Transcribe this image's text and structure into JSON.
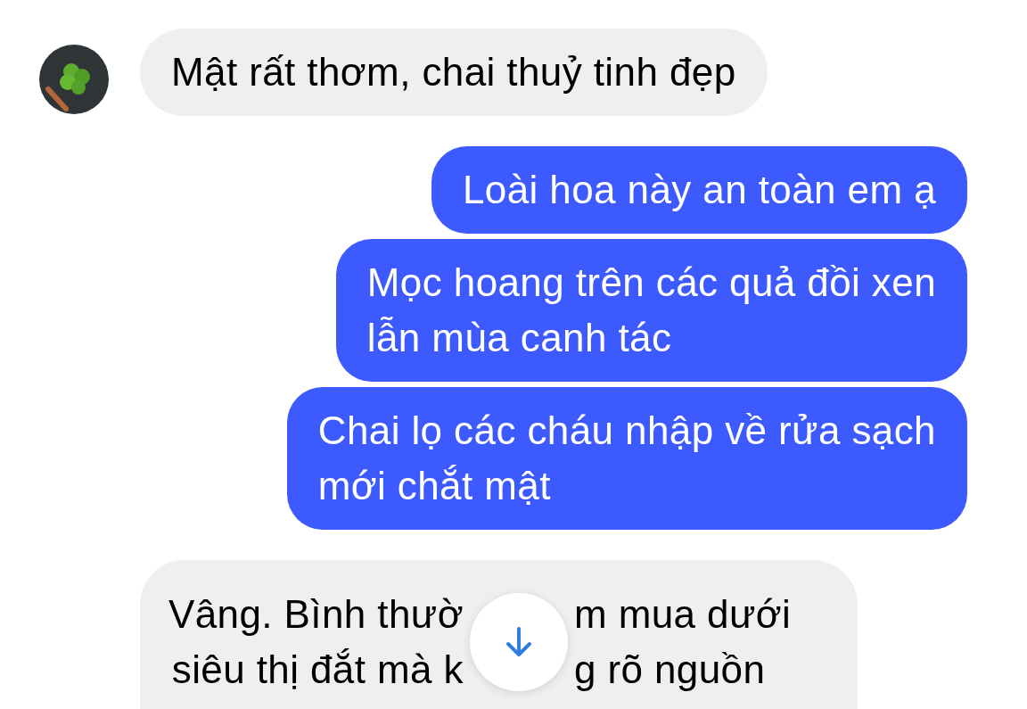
{
  "messages": [
    {
      "kind": "incoming",
      "avatar": true,
      "text": "Mật rất thơm, chai thuỷ tinh đẹp"
    },
    {
      "kind": "outgoing",
      "text": "Loài hoa này an toàn em ạ"
    },
    {
      "kind": "outgoing",
      "text": "Mọc hoang trên các quả đồi xen\nlẫn mùa canh tác"
    },
    {
      "kind": "outgoing",
      "text": "Chai lọ các cháu nhập về rửa sạch\nmới chắt mật"
    },
    {
      "kind": "covered",
      "avatar": false,
      "lines": [
        [
          "Vâng. Bình thườ",
          "m mua dưới"
        ],
        [
          "siêu thị đắt mà k",
          "g rõ nguồn"
        ]
      ]
    }
  ]
}
